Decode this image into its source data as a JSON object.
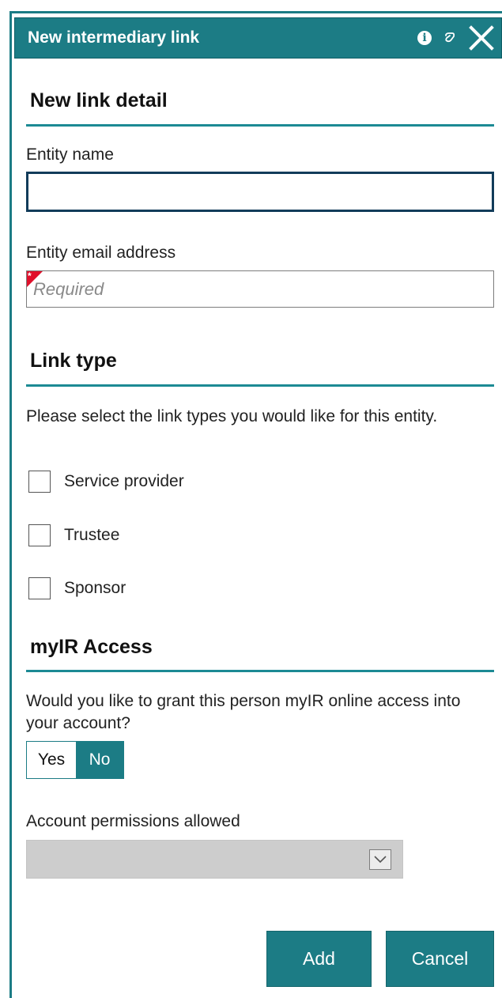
{
  "dialog": {
    "title": "New intermediary link",
    "icons": [
      "info-icon",
      "help-icon",
      "close-icon"
    ]
  },
  "sections": {
    "link_detail": {
      "heading": "New link detail"
    },
    "link_type": {
      "heading": "Link type",
      "description": "Please select the link types you would like for this entity.",
      "options": [
        {
          "label": "Service provider",
          "checked": false
        },
        {
          "label": "Trustee",
          "checked": false
        },
        {
          "label": "Sponsor",
          "checked": false
        }
      ]
    },
    "myir_access": {
      "heading": "myIR Access",
      "question": "Would you like to grant this person myIR online access into your account?",
      "toggle": {
        "yes": "Yes",
        "no": "No",
        "selected": "No"
      },
      "permissions_label": "Account permissions allowed",
      "permissions_value": ""
    }
  },
  "fields": {
    "entity_name": {
      "label": "Entity name",
      "value": "",
      "placeholder": ""
    },
    "entity_email": {
      "label": "Entity email address",
      "value": "",
      "placeholder": "Required"
    }
  },
  "buttons": {
    "add": "Add",
    "cancel": "Cancel"
  },
  "colors": {
    "accent": "#1c7c85",
    "required": "#e0102b",
    "focus_border": "#123c5a",
    "disabled": "#cdcdcd"
  }
}
